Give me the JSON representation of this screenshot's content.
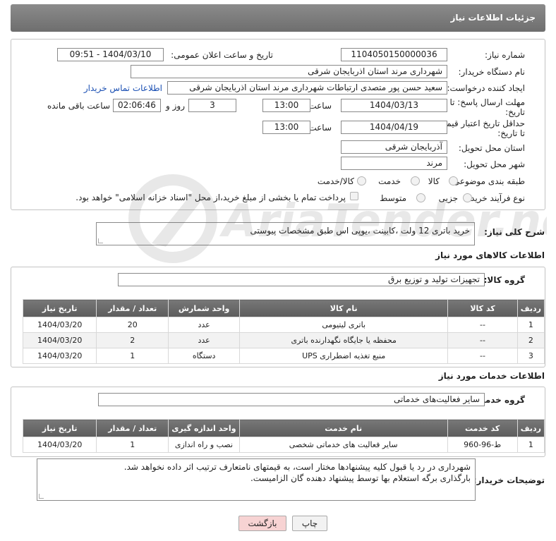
{
  "header": {
    "title": "جزئیات اطلاعات نیاز"
  },
  "form": {
    "need_number": {
      "label": "شماره نیاز:",
      "value": "1104050150000036"
    },
    "announce_datetime": {
      "label": "تاریخ و ساعت اعلان عمومی:",
      "value": "1404/03/10 - 09:51"
    },
    "buyer_org": {
      "label": "نام دستگاه خریدار:",
      "value": "شهرداری مرند استان اذربایجان شرقی"
    },
    "requester": {
      "label": "ایجاد کننده درخواست:",
      "value": "سعید حسن پور متصدی ارتباطات شهرداری مرند استان اذربایجان شرقی",
      "contact_link": "اطلاعات تماس خریدار"
    },
    "reply_deadline": {
      "label_line1": "مهلت ارسال پاسخ: تا",
      "label_line2": "تاریخ:",
      "date": "1404/03/13",
      "time_label": "ساعت",
      "time": "13:00",
      "days": "3",
      "days_label": "روز و",
      "remaining": "02:06:46",
      "remaining_label": "ساعت باقی مانده"
    },
    "price_validity": {
      "label_line1": "حداقل تاریخ اعتبار قیمت:",
      "label_line2": "تا تاریخ:",
      "date": "1404/04/19",
      "time_label": "ساعت",
      "time": "13:00"
    },
    "delivery_province": {
      "label": "استان محل تحویل:",
      "value": "آذربایجان شرقی"
    },
    "delivery_city": {
      "label": "شهر محل تحویل:",
      "value": "مرند"
    },
    "category": {
      "label": "طبقه بندی موضوعی:",
      "options": [
        "کالا",
        "خدمت",
        "کالا/خدمت"
      ]
    },
    "purchase_type": {
      "label": "نوع فرآیند خرید :",
      "options": [
        "جزیی",
        "متوسط"
      ],
      "payment_note": "پرداخت تمام یا بخشی از مبلغ خرید،از محل \"اسناد خزانه اسلامی\" خواهد بود."
    }
  },
  "description": {
    "label": "شرح کلی نیاز:",
    "value": "خرید باتری 12 ولت ،کابینت ،یوپی اس طبق مشخصات پیوستی"
  },
  "goods": {
    "section_title": "اطلاعات کالاهای مورد نیاز",
    "group_label": "گروه کالا:",
    "group_value": "تجهیزات تولید و توزیع برق",
    "columns": [
      "ردیف",
      "کد کالا",
      "نام کالا",
      "واحد شمارش",
      "تعداد / مقدار",
      "تاریخ نیاز"
    ],
    "rows": [
      [
        "1",
        "--",
        "باتری لیتیومی",
        "عدد",
        "20",
        "1404/03/20"
      ],
      [
        "2",
        "--",
        "محفظه یا جایگاه نگهدارنده باتری",
        "عدد",
        "2",
        "1404/03/20"
      ],
      [
        "3",
        "--",
        "منبع تغذیه اضطراری UPS",
        "دستگاه",
        "1",
        "1404/03/20"
      ]
    ]
  },
  "services": {
    "section_title": "اطلاعات خدمات مورد نیاز",
    "group_label": "گروه خدمت:",
    "group_value": "سایر فعالیت‌های خدماتی",
    "columns": [
      "ردیف",
      "کد خدمت",
      "نام خدمت",
      "واحد اندازه گیری",
      "تعداد / مقدار",
      "تاریخ نیاز"
    ],
    "rows": [
      [
        "1",
        "ط-96-960",
        "سایر فعالیت های خدماتی شخصی",
        "نصب و راه اندازی",
        "1",
        "1404/03/20"
      ]
    ]
  },
  "buyer_notes": {
    "label": "توضیحات خریدار:",
    "line1": "شهرداری در رد یا قبول کلیه پیشنهادها مختار است، به قیمتهای نامتعارف ترتیب اثر داده نخواهد شد.",
    "line2": "بارگذاری برگه استعلام بها توسط پیشنهاد دهنده گان الزامیست."
  },
  "buttons": {
    "print": "چاپ",
    "back": "بازگشت"
  },
  "watermark": {
    "text": "AriaTender.net"
  },
  "colors": {
    "header_bg": "#7c7c7c",
    "link": "#1a4fb3",
    "back_button_bg": "#f7d3d3",
    "print_button_bg": "#f2f2f2"
  }
}
